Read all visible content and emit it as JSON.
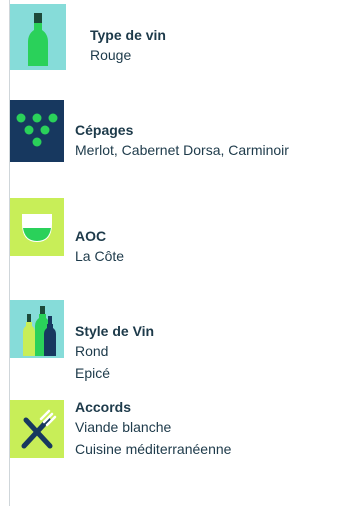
{
  "colors": {
    "teal_tile": "#86dcd9",
    "navy_tile": "#17385f",
    "lime_tile": "#c8ee58",
    "green_accent": "#2ad15a",
    "text": "#1d3a4a"
  },
  "items": [
    {
      "icon": "wine-bottle-icon",
      "title": "Type de vin",
      "lines": [
        "Rouge"
      ]
    },
    {
      "icon": "grapes-icon",
      "title": "Cépages",
      "lines": [
        "Merlot, Cabernet Dorsa, Carminoir"
      ]
    },
    {
      "icon": "wine-glass-icon",
      "title": "AOC",
      "lines": [
        "La Côte"
      ]
    },
    {
      "icon": "bottles-icon",
      "title": "Style de Vin",
      "lines": [
        "Rond",
        "Epicé"
      ]
    },
    {
      "icon": "knife-fork-icon",
      "title": "Accords",
      "lines": [
        "Viande blanche",
        "Cuisine méditerranéenne"
      ]
    }
  ]
}
